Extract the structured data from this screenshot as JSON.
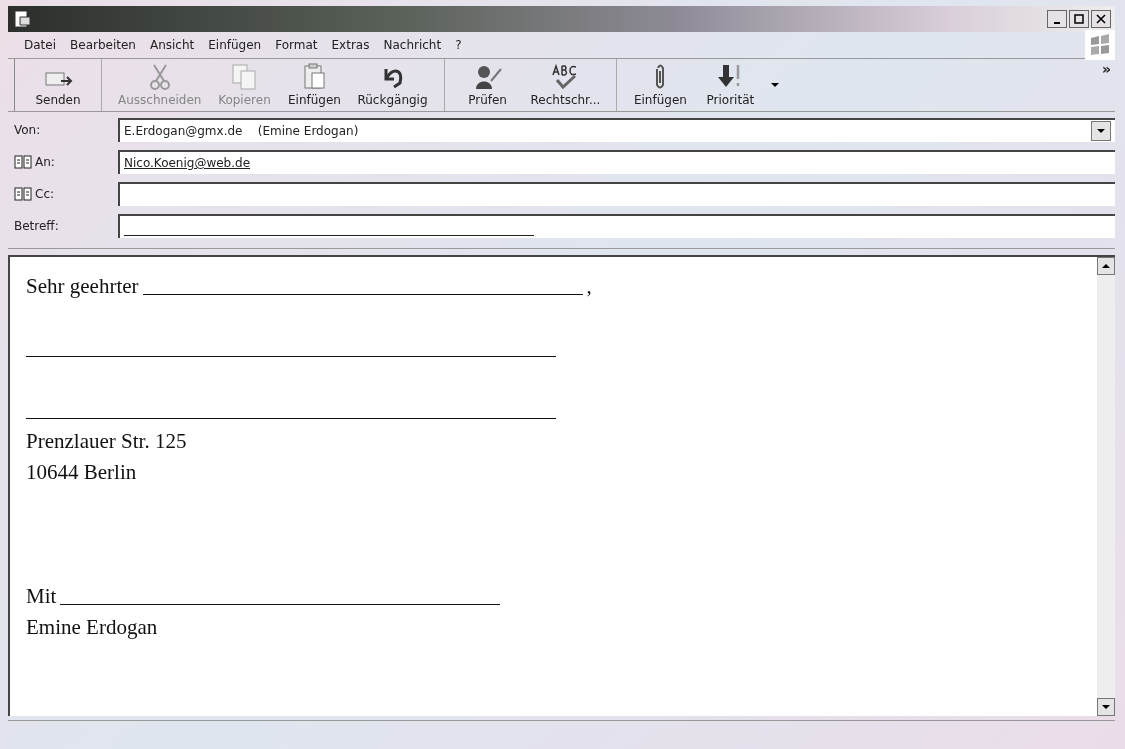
{
  "menu": [
    {
      "label": "Datei"
    },
    {
      "label": "Bearbeiten"
    },
    {
      "label": "Ansicht"
    },
    {
      "label": "Einfügen"
    },
    {
      "label": "Format"
    },
    {
      "label": "Extras"
    },
    {
      "label": "Nachricht"
    },
    {
      "label": "?"
    }
  ],
  "toolbar": [
    [
      {
        "kind": "send",
        "label": "Senden",
        "disabled": false
      }
    ],
    [
      {
        "kind": "cut",
        "label": "Ausschneiden",
        "disabled": true
      },
      {
        "kind": "copy",
        "label": "Kopieren",
        "disabled": true
      },
      {
        "kind": "paste",
        "label": "Einfügen",
        "disabled": false
      },
      {
        "kind": "undo",
        "label": "Rückgängig",
        "disabled": false
      }
    ],
    [
      {
        "kind": "check",
        "label": "Prüfen",
        "disabled": false
      },
      {
        "kind": "spelling",
        "label": "Rechtschr...",
        "disabled": false
      }
    ],
    [
      {
        "kind": "attach",
        "label": "Einfügen",
        "disabled": false
      },
      {
        "kind": "priority",
        "label": "Priorität",
        "disabled": false
      }
    ]
  ],
  "toolbar_more": "»",
  "fields": [
    {
      "kind": "dropdown",
      "label": "Von:",
      "value": "E.Erdogan@gmx.de    (Emine Erdogan)"
    },
    {
      "kind": "address",
      "label": "An:",
      "value": "Nico.Koenig@web.de"
    },
    {
      "kind": "address",
      "label": "Cc:"
    },
    {
      "kind": "blank",
      "label": "Betreff:"
    }
  ],
  "body": [
    {
      "parts": [
        {
          "kind": "text",
          "text": "Sehr geehrter"
        },
        {
          "kind": "blank"
        },
        {
          "kind": "text",
          "text": ","
        }
      ]
    },
    {
      "kind": "gap"
    },
    {
      "parts": [
        {
          "kind": "blank"
        }
      ]
    },
    {
      "kind": "gap"
    },
    {
      "parts": [
        {
          "kind": "blank"
        }
      ]
    },
    {
      "parts": [
        {
          "kind": "text",
          "text": "Prenzlauer Str. 125"
        }
      ]
    },
    {
      "parts": [
        {
          "kind": "text",
          "text": "10644 Berlin"
        }
      ]
    },
    {
      "kind": "gap"
    },
    {
      "kind": "gap"
    },
    {
      "kind": "gap"
    },
    {
      "parts": [
        {
          "kind": "text",
          "text": "Mit"
        },
        {
          "kind": "blank"
        }
      ]
    },
    {
      "parts": [
        {
          "kind": "text",
          "text": "Emine Erdogan"
        }
      ]
    }
  ]
}
